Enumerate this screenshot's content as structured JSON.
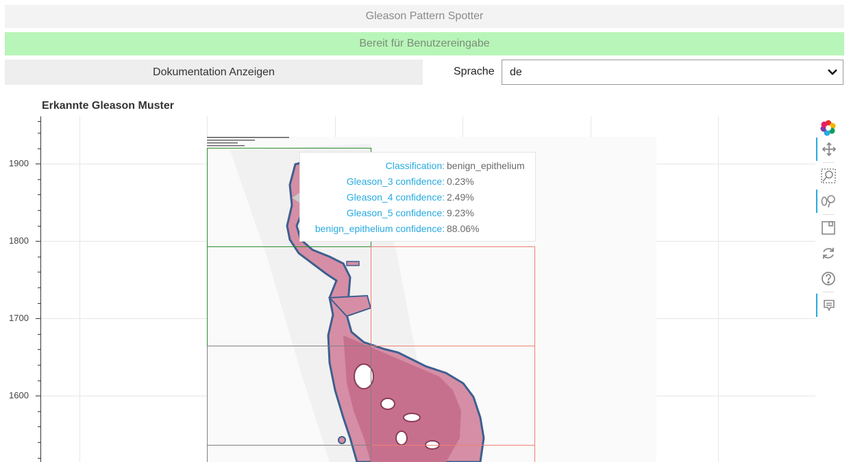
{
  "app": {
    "title": "Gleason Pattern Spotter"
  },
  "status": {
    "text": "Bereit für Benutzereingabe",
    "color": "#b8f5b8"
  },
  "controls": {
    "doc_button_label": "Dokumentation Anzeigen",
    "language_label": "Sprache",
    "language_value": "de"
  },
  "plot": {
    "title": "Erkannte Gleason Muster",
    "y_ticks": [
      "1900",
      "1800",
      "1700",
      "1600"
    ],
    "box_colors": {
      "benign": "#2e8b2e",
      "gleason": "#f08070",
      "other": "#808080"
    }
  },
  "toolbar": {
    "tools": [
      "bokeh-logo-icon",
      "pan-icon",
      "box-zoom-icon",
      "wheel-zoom-icon",
      "save-icon",
      "reset-icon",
      "help-icon",
      "hover-icon"
    ]
  },
  "tooltip": {
    "rows": [
      {
        "key": "Classification:",
        "value": "benign_epithelium"
      },
      {
        "key": "Gleason_3 confidence:",
        "value": "0.23%"
      },
      {
        "key": "Gleason_4 confidence:",
        "value": "2.49%"
      },
      {
        "key": "Gleason_5 confidence:",
        "value": "9.23%"
      },
      {
        "key": "benign_epithelium confidence:",
        "value": "88.06%"
      }
    ]
  }
}
